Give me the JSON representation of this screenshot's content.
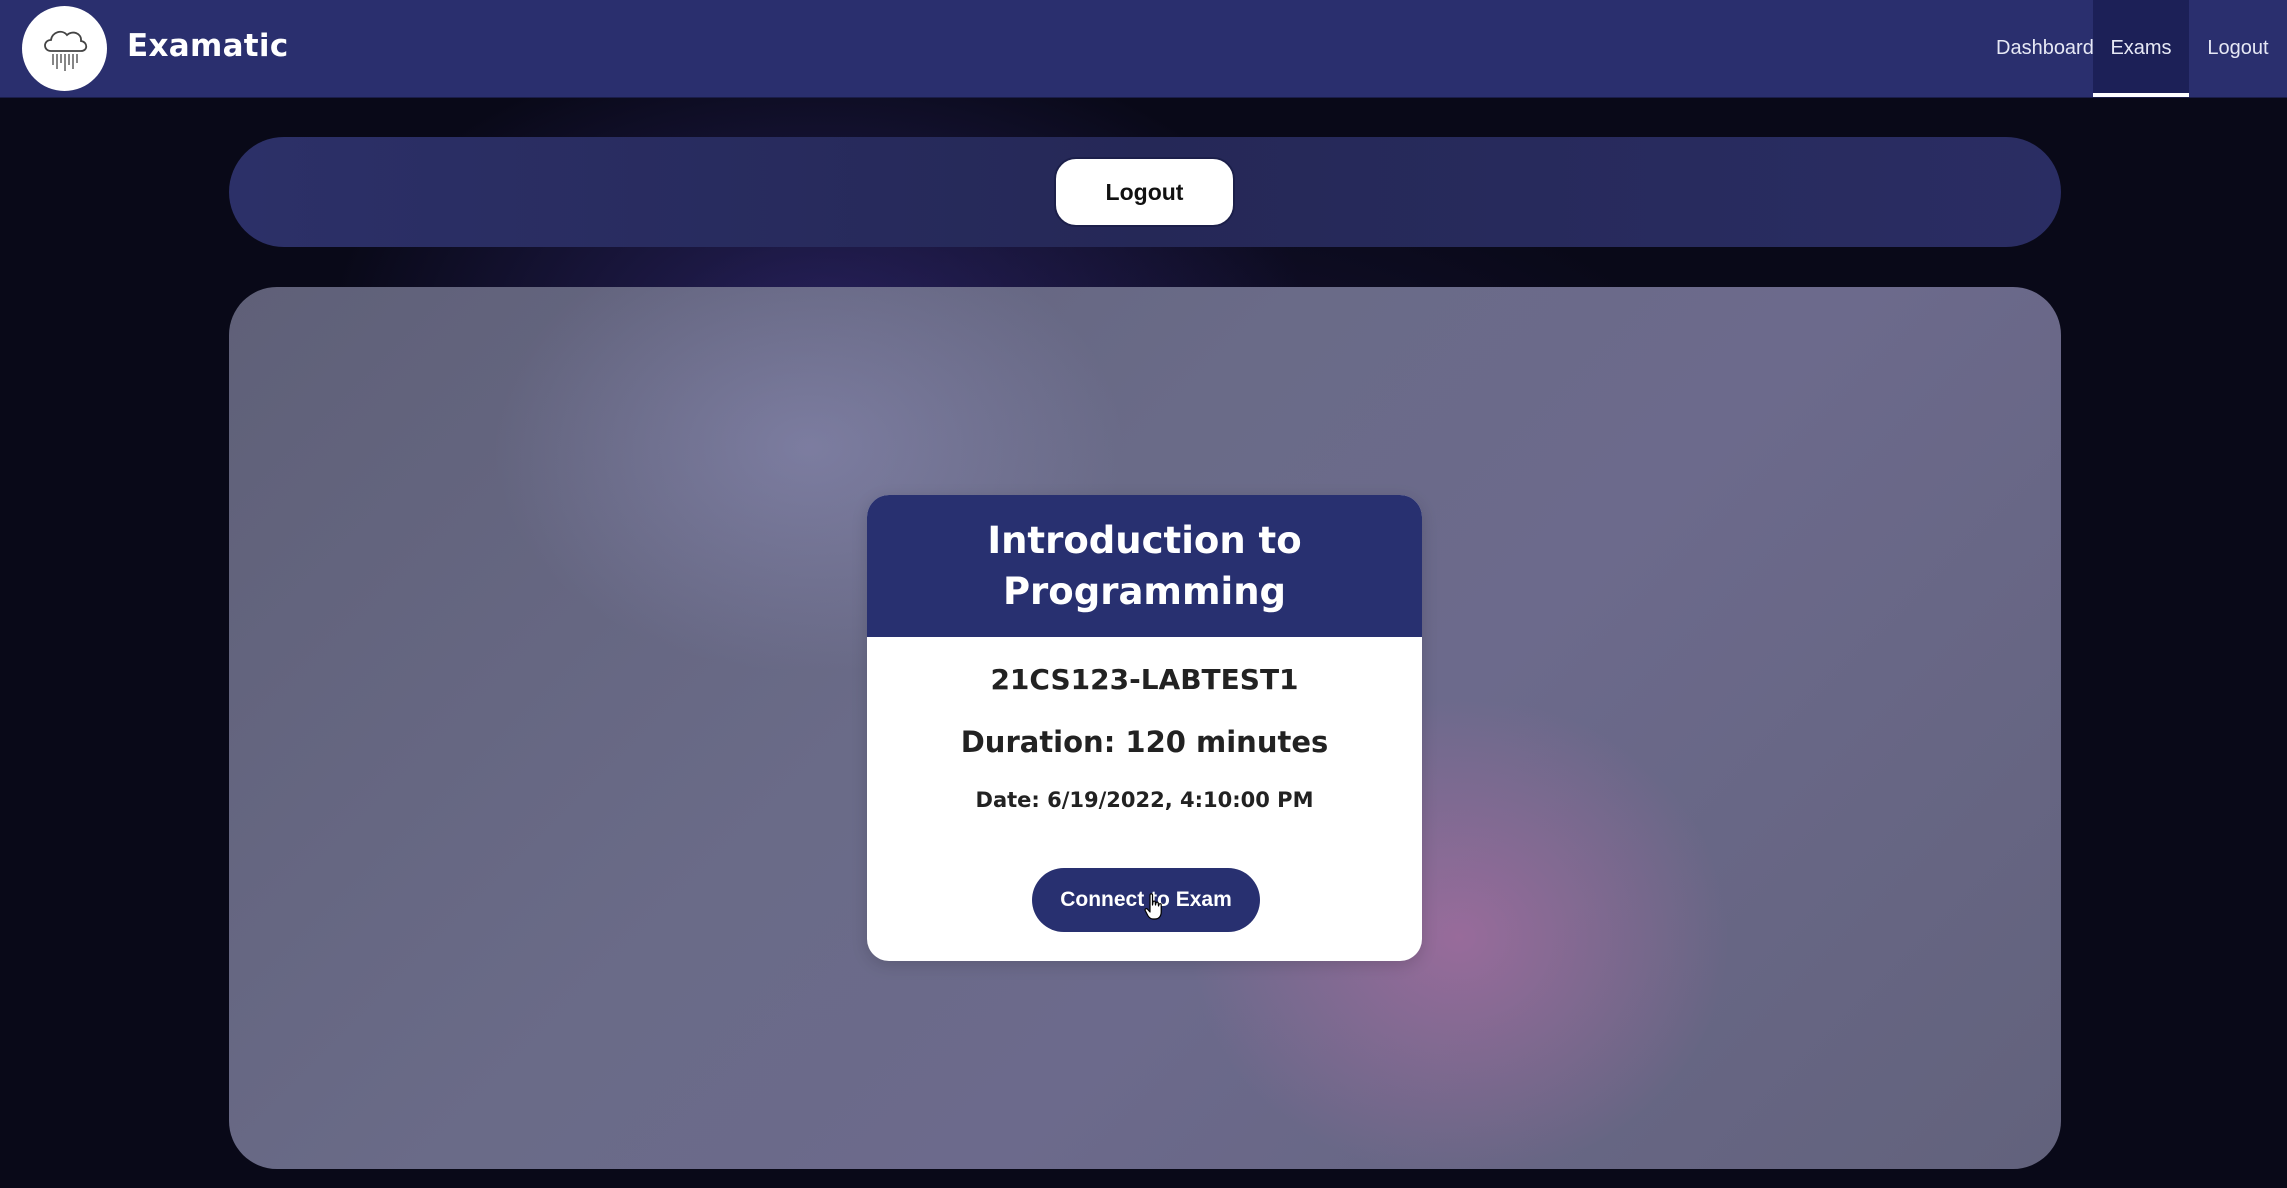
{
  "app": {
    "brand": "Examatic",
    "logo_icon": "cloud-rain-icon"
  },
  "nav": {
    "items": [
      {
        "label": "Dashboard",
        "active": false
      },
      {
        "label": "Exams",
        "active": true
      },
      {
        "label": "Logout",
        "active": false
      }
    ]
  },
  "top_panel": {
    "logout_label": "Logout"
  },
  "exam_card": {
    "title": "Introduction to Programming",
    "code": "21CS123-LABTEST1",
    "duration": "Duration: 120 minutes",
    "date": "Date: 6/19/2022, 4:10:00 PM",
    "connect_label": "Connect to Exam"
  },
  "colors": {
    "navbar": "#2a2f6e",
    "card_header": "#283070",
    "button_primary": "#283070"
  }
}
